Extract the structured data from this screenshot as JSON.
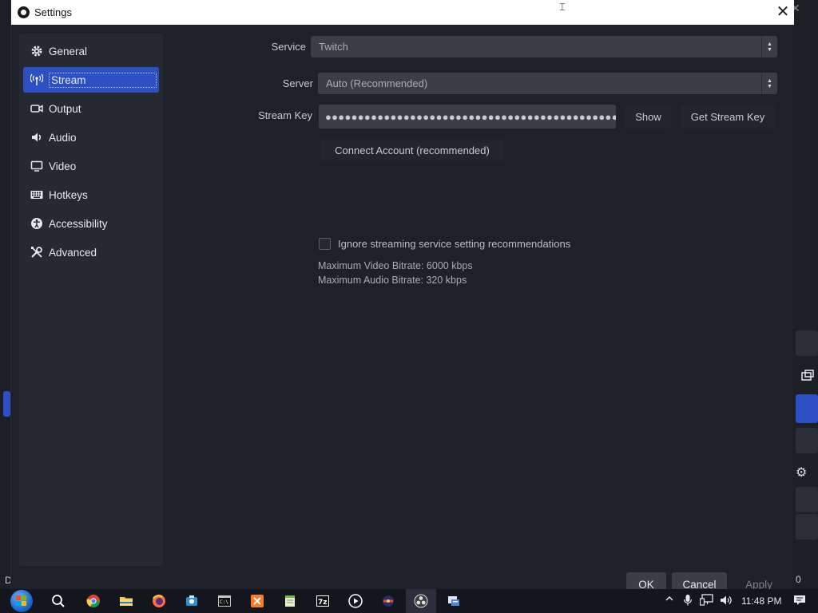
{
  "window": {
    "title": "Settings"
  },
  "sidebar": {
    "items": [
      {
        "label": "General",
        "icon": "gear-icon"
      },
      {
        "label": "Stream",
        "icon": "antenna-icon",
        "active": true
      },
      {
        "label": "Output",
        "icon": "output-icon"
      },
      {
        "label": "Audio",
        "icon": "speaker-icon"
      },
      {
        "label": "Video",
        "icon": "monitor-icon"
      },
      {
        "label": "Hotkeys",
        "icon": "keyboard-icon"
      },
      {
        "label": "Accessibility",
        "icon": "accessibility-icon"
      },
      {
        "label": "Advanced",
        "icon": "tools-icon"
      }
    ]
  },
  "stream": {
    "service_label": "Service",
    "service_value": "Twitch",
    "server_label": "Server",
    "server_value": "Auto (Recommended)",
    "key_label": "Stream Key",
    "key_value": "●●●●●●●●●●●●●●●●●●●●●●●●●●●●●●●●●●●●●●●●●●●●●●●●●●●●",
    "show_button": "Show",
    "get_key_button": "Get Stream Key",
    "connect_button": "Connect Account (recommended)",
    "ignore_checkbox_label": "Ignore streaming service setting recommendations",
    "ignore_checked": false,
    "max_video_bitrate": "Maximum Video Bitrate: 6000 kbps",
    "max_audio_bitrate": "Maximum Audio Bitrate: 320 kbps"
  },
  "footer": {
    "ok": "OK",
    "cancel": "Cancel",
    "apply": "Apply"
  },
  "taskbar": {
    "clock": "11:48 PM",
    "apps": [
      "search-icon",
      "chrome-icon",
      "file-explorer-icon",
      "firefox-icon",
      "app-icon",
      "terminal-icon",
      "xampp-icon",
      "notepad-icon",
      "7zip-icon",
      "media-player-icon",
      "app-icon",
      "obs-icon",
      "app-icon"
    ]
  },
  "background": {
    "bottom_left_text": "D",
    "bottom_right_text": "0"
  },
  "colors": {
    "accent": "#2c4fc4",
    "dialog_bg": "#1f212a",
    "panel_bg": "#262932",
    "field_bg": "#3b3e48"
  }
}
